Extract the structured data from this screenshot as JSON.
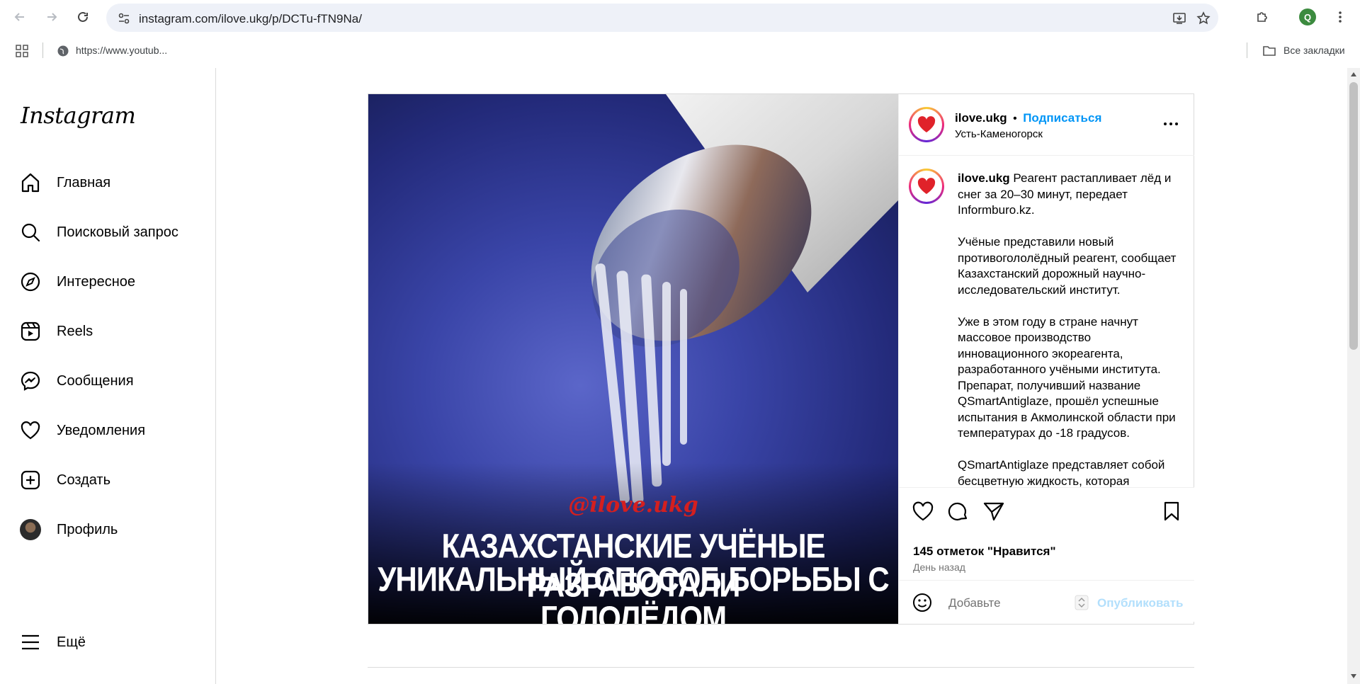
{
  "browser": {
    "url": "instagram.com/ilove.ukg/p/DCTu-fTN9Na/",
    "profile_initial": "Q",
    "bookmark_item": "https://www.youtub...",
    "all_bookmarks": "Все закладки"
  },
  "sidebar": {
    "logo": "Instagram",
    "items": [
      {
        "label": "Главная",
        "icon": "home-icon"
      },
      {
        "label": "Поисковый запрос",
        "icon": "search-icon"
      },
      {
        "label": "Интересное",
        "icon": "compass-icon"
      },
      {
        "label": "Reels",
        "icon": "reels-icon"
      },
      {
        "label": "Сообщения",
        "icon": "messenger-icon"
      },
      {
        "label": "Уведомления",
        "icon": "heart-icon"
      },
      {
        "label": "Создать",
        "icon": "plus-square-icon"
      },
      {
        "label": "Профиль",
        "icon": "avatar"
      }
    ],
    "more": "Ещё"
  },
  "post": {
    "image": {
      "watermark": "@ilove.ukg",
      "headline_line1": "КАЗАХСТАНСКИЕ УЧЁНЫЕ РАЗРАБОТАЛИ",
      "headline_line2": "УНИКАЛЬНЫЙ СПОСОБ БОРЬБЫ С ГОЛОЛЁДОМ"
    },
    "header": {
      "username": "ilove.ukg",
      "dot": "•",
      "follow": "Подписаться",
      "location": "Усть-Каменогорск"
    },
    "caption": {
      "username": "ilove.ukg",
      "p1": " Реагент растапливает лёд и снег за 20–30 минут, передает Informburo.kz.",
      "p2": "Учёные представили новый противогололёдный реагент, сообщает Казахстанский дорожный научно-исследовательский институт.",
      "p3": "Уже в этом году в стране начнут массовое производство инновационного экореагента, разработанного учёными института. Препарат, получивший название QSmartAntiglaze, прошёл успешные испытания в Акмолинской области при температурах до -18 градусов.",
      "p4": "QSmartAntiglaze представляет собой бесцветную жидкость, которая"
    },
    "likes": "145 отметок \"Нравится\"",
    "time": "День назад",
    "comment_placeholder": "Добавьте",
    "publish": "Опубликовать"
  }
}
